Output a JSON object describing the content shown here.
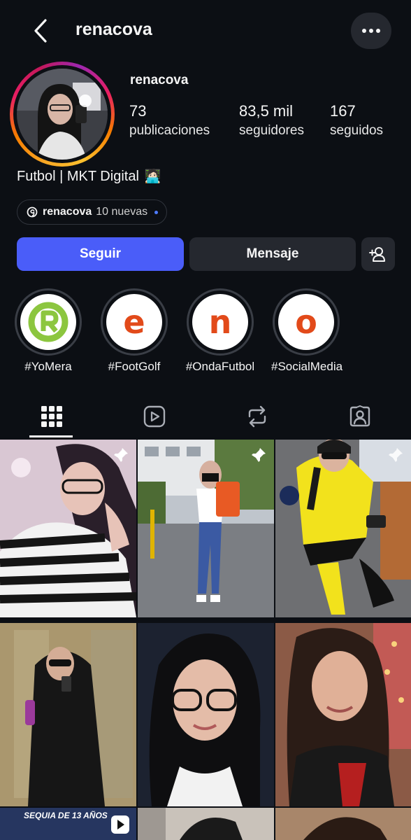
{
  "header": {
    "title": "renacova",
    "back_icon": "chevron-left-icon",
    "more_icon": "more-dots-icon"
  },
  "profile": {
    "username": "renacova",
    "posts_count": "73",
    "posts_label": "publicaciones",
    "followers_count": "83,5 mil",
    "followers_label": "seguidores",
    "following_count": "167",
    "following_label": "seguidos",
    "bio": "Futbol | MKT Digital",
    "bio_emoji": "🧑🏻‍💻"
  },
  "threads": {
    "name": "renacova",
    "new_label": "10 nuevas"
  },
  "actions": {
    "follow": "Seguir",
    "message": "Mensaje",
    "add_icon": "add-person-icon"
  },
  "highlights": [
    {
      "label": "#YoMera",
      "letter": "®"
    },
    {
      "label": "#FootGolf",
      "letter": "e"
    },
    {
      "label": "#OndaFutbol",
      "letter": "n"
    },
    {
      "label": "#SocialMedia",
      "letter": "o"
    }
  ],
  "tabs": [
    "grid-icon",
    "reels-icon",
    "reposts-icon",
    "tagged-icon"
  ],
  "grid": {
    "video_banner": "SEQUIA DE 13 AÑOS"
  },
  "colors": {
    "accent": "#4a5df9",
    "background": "#0c0f14",
    "button_dark": "#25282f"
  }
}
